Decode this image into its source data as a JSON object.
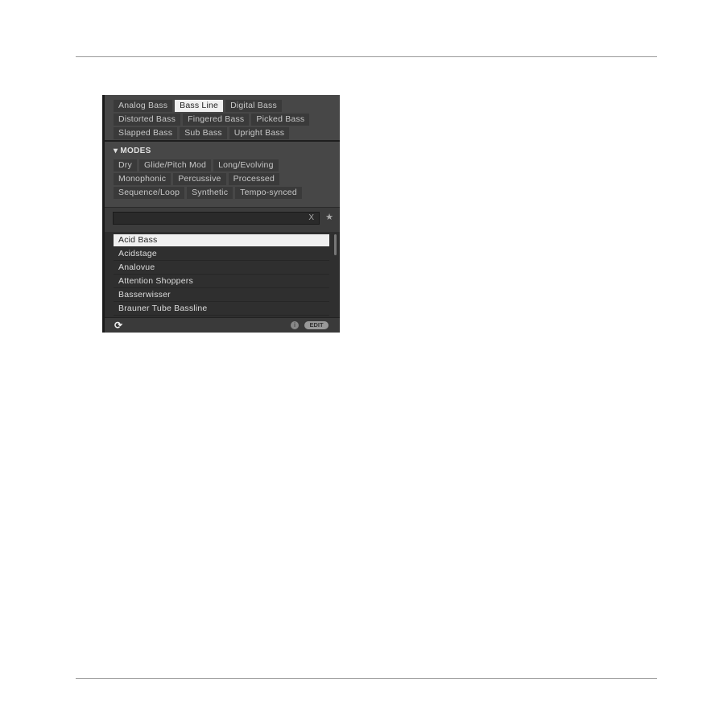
{
  "types": [
    "Analog Bass",
    "Bass Line",
    "Digital Bass",
    "Distorted Bass",
    "Fingered Bass",
    "Picked Bass",
    "Slapped Bass",
    "Sub Bass",
    "Upright Bass"
  ],
  "selected_type": "Bass Line",
  "modes": {
    "header": "MODES",
    "items": [
      "Dry",
      "Glide/Pitch Mod",
      "Long/Evolving",
      "Monophonic",
      "Percussive",
      "Processed",
      "Sequence/Loop",
      "Synthetic",
      "Tempo-synced"
    ]
  },
  "search": {
    "value": "",
    "clear_label": "X",
    "favorite_icon": "star-icon"
  },
  "results": [
    "Acid Bass",
    "Acidstage",
    "Analovue",
    "Attention Shoppers",
    "Basserwisser",
    "Brauner Tube Bassline"
  ],
  "selected_result": "Acid Bass",
  "footer": {
    "sync_icon": "refresh-icon",
    "info_label": "i",
    "edit_label": "EDIT"
  }
}
